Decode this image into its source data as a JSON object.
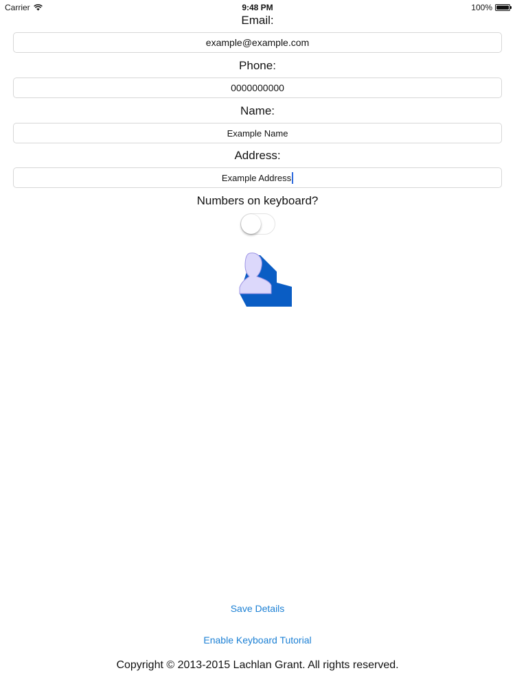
{
  "status_bar": {
    "carrier": "Carrier",
    "time": "9:48 PM",
    "battery": "100%"
  },
  "form": {
    "email_label": "Email:",
    "email_value": "example@example.com",
    "phone_label": "Phone:",
    "phone_value": "0000000000",
    "name_label": "Name:",
    "name_value": "Example Name",
    "address_label": "Address:",
    "address_value": "Example Address",
    "keyboard_toggle_label": "Numbers on keyboard?",
    "keyboard_toggle_on": false
  },
  "buttons": {
    "save": "Save Details",
    "tutorial": "Enable Keyboard Tutorial"
  },
  "footer": {
    "copyright": "Copyright © 2013-2015 Lachlan Grant. All rights reserved."
  },
  "colors": {
    "link": "#1a7fd4",
    "contact_icon_front": "#dcd8fb",
    "contact_icon_shadow": "#0a5dc4"
  },
  "icons": {
    "contact": "contact-person-icon"
  }
}
